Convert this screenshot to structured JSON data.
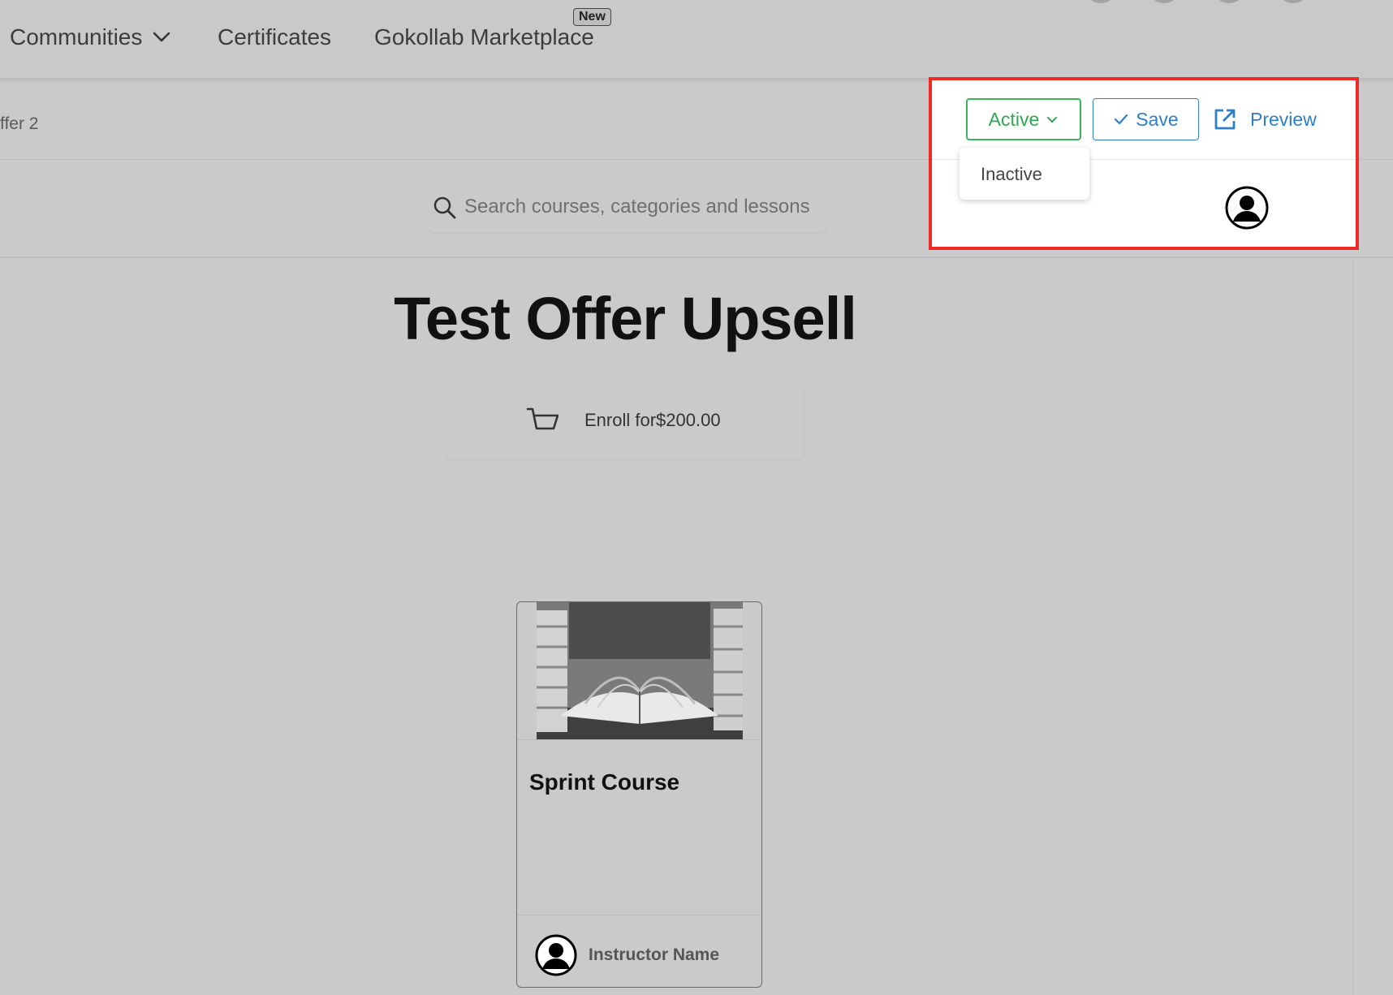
{
  "nav": {
    "items": [
      {
        "label": "Communities"
      },
      {
        "label": "Certificates"
      },
      {
        "label": "Gokollab Marketplace"
      }
    ],
    "new_badge": "New"
  },
  "breadcrumb": {
    "text": "ffer 2"
  },
  "search": {
    "placeholder": "Search courses, categories and lessons"
  },
  "actions": {
    "status": "Active",
    "dropdown_options": [
      "Inactive"
    ],
    "save_label": "Save",
    "preview_label": "Preview"
  },
  "offer": {
    "title": "Test Offer Upsell",
    "enroll_text": "Enroll for$200.00"
  },
  "course_card": {
    "title": "Sprint Course",
    "instructor": "Instructor Name"
  },
  "colors": {
    "highlight_border": "#ee2a24",
    "active_green": "#2fa84f",
    "link_blue": "#2e7ec9",
    "background": "#cacaca"
  },
  "icons": [
    "chevron-down-icon",
    "search-icon",
    "check-icon",
    "external-link-icon",
    "user-avatar-icon",
    "cart-icon"
  ]
}
